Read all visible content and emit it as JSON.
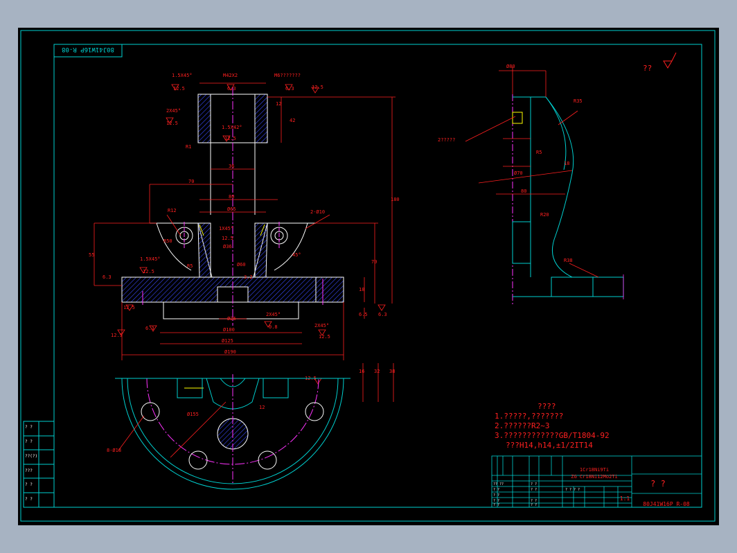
{
  "drawing": {
    "code_rotated": "80J41W16P R-08",
    "roughness_other": "??",
    "dimensions": {
      "chamfer_top_left": "1.5X45°",
      "thread_top": "M42X2",
      "thread_top_right": "M6???????",
      "rough_top_left": "12.5",
      "rough_top_mid": "6.3",
      "rough_top_right": "6.3",
      "rough_top_far": "12.5",
      "chamfer_left2": "2X45°",
      "rough_left2": "12.5",
      "dim_12": "12",
      "dim_42": "42",
      "chamfer_inner": "1.5X42°",
      "rough_inner": "12.5",
      "r1": "R1",
      "d36": "36",
      "d70": "70",
      "d80": "80",
      "d65": "Ø65",
      "r12": "R12",
      "hole_note": "2-Ø10",
      "chamfer_mid": "1X45°",
      "rough_mid": "12.5",
      "d36_tol": "Ø36",
      "r50": "R50",
      "d180": "180",
      "d55": "55",
      "d70v": "70",
      "r55": "R5",
      "angle45": "45°",
      "d60": "Ø60",
      "rough_side": "6.3",
      "chamfer_base": "1.5X45°",
      "rough_base": "12.5",
      "rough_base_v": "3.2",
      "d18": "18",
      "d5": "6.5",
      "rough_r": "6.3",
      "rough_bot_left": "12.5",
      "d26": "Ø26",
      "chamfer_bot": "2X45°",
      "rough_bot_mid": "0.8",
      "chamfer_bot_r": "2X45°",
      "rough_bot_r": "12.5",
      "rough_low_l": "12.5",
      "rough_low_l2": "6.3",
      "d100": "Ø100",
      "d125": "Ø125",
      "d190": "Ø190",
      "rough_plan": "12.5",
      "d16": "16",
      "d32": "32",
      "d38": "38",
      "d155": "Ø155",
      "d12p": "12",
      "holes_bottom": "8-Ø18",
      "side_d80": "Ø80",
      "side_r35": "R35",
      "side_note": "2?????",
      "side_r5": "R5",
      "side_d70": "Ø70",
      "side_18": "18",
      "side_80": "80",
      "side_r20": "R20",
      "side_r38": "R38"
    },
    "notes": {
      "heading": "????",
      "line1": "1.?????,???????",
      "line2": "2.??????R2~3",
      "line3": "3.????????????GB/T1804-92",
      "line4": "???H14,h14,±1/2IT14"
    },
    "title_block": {
      "material1": "1Cr18Ni9Ti",
      "material2": "ZG Cr18Ni12Mo2Ti",
      "name": "? ?",
      "scale": "1:1",
      "code": "80J41W16P R-08",
      "cells": [
        "?? ??",
        "? ?",
        "? ?",
        "? ?",
        "? ?",
        "? ? ? ?",
        "? ?",
        "? ?",
        "? ?",
        "? ?"
      ]
    },
    "left_strip": {
      "labels": [
        "? ?",
        "? ?",
        "??(?)",
        "???",
        "? ?",
        "? ?"
      ]
    }
  }
}
